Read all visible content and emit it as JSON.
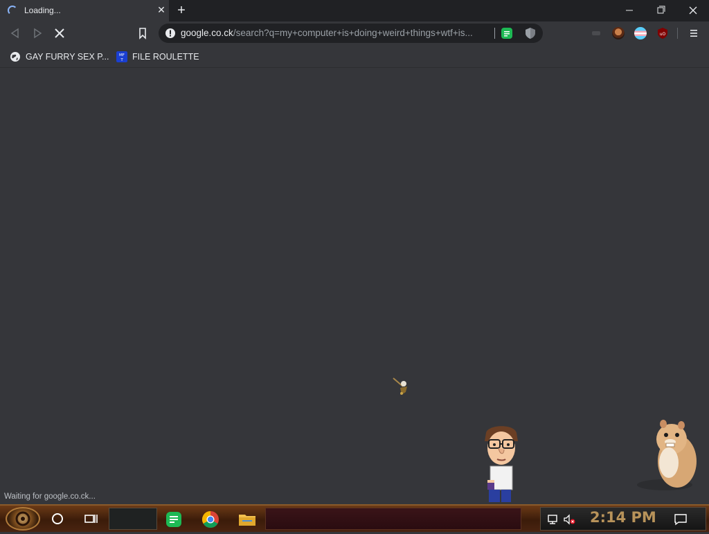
{
  "tab": {
    "title": "Loading...",
    "close_glyph": "✕",
    "new_tab_glyph": "+"
  },
  "address": {
    "host": "google.co.ck",
    "path": "/search?q=my+computer+is+doing+weird+things+wtf+is..."
  },
  "bookmarks": [
    {
      "label": "GAY FURRY SEX P...",
      "icon": "globe-icon"
    },
    {
      "label": "FILE ROULETTE",
      "icon": "mft-icon",
      "icon_text": "MF T"
    }
  ],
  "status_text": "Waiting for google.co.ck...",
  "taskbar": {
    "clock": "2:14 PM"
  },
  "colors": {
    "content_bg": "#35363a",
    "tab_strip": "#202124",
    "accent_green": "#1db954",
    "clock": "#b8935a"
  }
}
